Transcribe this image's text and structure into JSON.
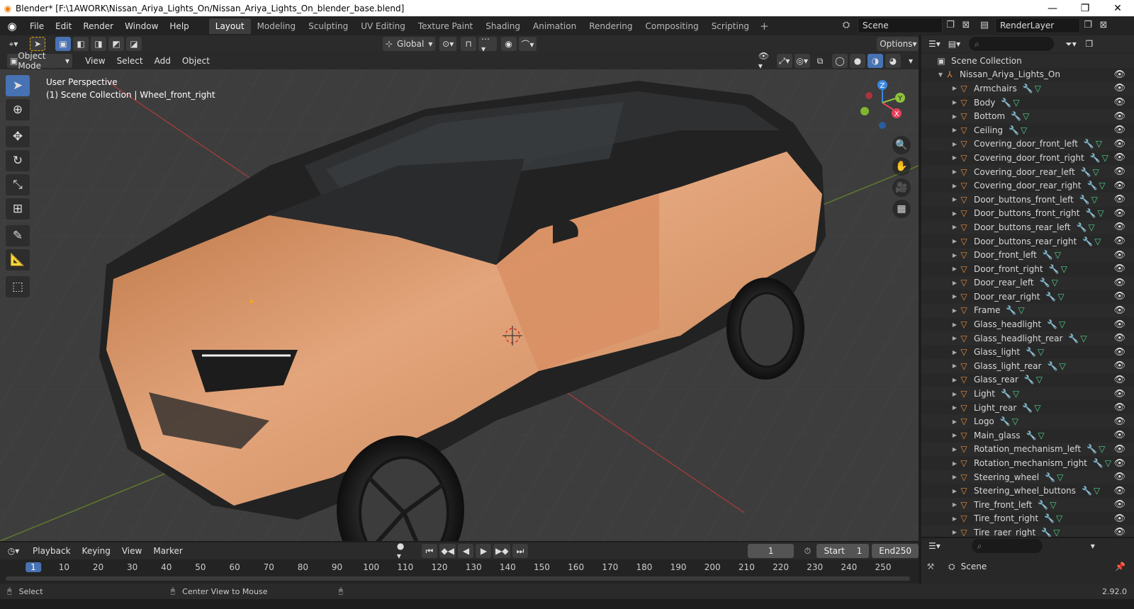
{
  "window": {
    "title": "Blender* [F:\\1AWORK\\Nissan_Ariya_Lights_On/Nissan_Ariya_Lights_On_blender_base.blend]",
    "minimize": "—",
    "maximize": "❐",
    "close": "✕"
  },
  "menus": [
    "File",
    "Edit",
    "Render",
    "Window",
    "Help"
  ],
  "workspaces": [
    "Layout",
    "Modeling",
    "Sculpting",
    "UV Editing",
    "Texture Paint",
    "Shading",
    "Animation",
    "Rendering",
    "Compositing",
    "Scripting"
  ],
  "active_workspace": "Layout",
  "scene": {
    "name": "Scene",
    "render_layer": "RenderLayer"
  },
  "viewport_header": {
    "transform_orientation": "Global",
    "options": "Options",
    "mode": "Object Mode",
    "menus": [
      "View",
      "Select",
      "Add",
      "Object"
    ]
  },
  "viewport_info": {
    "line1": "User Perspective",
    "line2": "(1) Scene Collection | Wheel_front_right"
  },
  "gizmo": {
    "x": "X",
    "y": "Y",
    "z": "Z"
  },
  "outliner": {
    "root": "Scene Collection",
    "collection": "Nissan_Ariya_Lights_On",
    "objects": [
      "Armchairs",
      "Body",
      "Bottom",
      "Ceiling",
      "Covering_door_front_left",
      "Covering_door_front_right",
      "Covering_door_rear_left",
      "Covering_door_rear_right",
      "Door_buttons_front_left",
      "Door_buttons_front_right",
      "Door_buttons_rear_left",
      "Door_buttons_rear_right",
      "Door_front_left",
      "Door_front_right",
      "Door_rear_left",
      "Door_rear_right",
      "Frame",
      "Glass_headlight",
      "Glass_headlight_rear",
      "Glass_light",
      "Glass_light_rear",
      "Glass_rear",
      "Light",
      "Light_rear",
      "Logo",
      "Main_glass",
      "Rotation_mechanism_left",
      "Rotation_mechanism_right",
      "Steering_wheel",
      "Steering_wheel_buttons",
      "Tire_front_left",
      "Tire_front_right",
      "Tire_raer_right"
    ]
  },
  "properties": {
    "scene_label": "Scene"
  },
  "timeline": {
    "menus": [
      "Playback",
      "Keying",
      "View",
      "Marker"
    ],
    "current_frame": "1",
    "start_label": "Start",
    "start": "1",
    "end_label": "End",
    "end": "250",
    "ticks": [
      "1",
      "10",
      "20",
      "30",
      "40",
      "50",
      "60",
      "70",
      "80",
      "90",
      "100",
      "110",
      "120",
      "130",
      "140",
      "150",
      "160",
      "170",
      "180",
      "190",
      "200",
      "210",
      "220",
      "230",
      "240",
      "250"
    ]
  },
  "status": {
    "select": "Select",
    "center_view": "Center View to Mouse",
    "version": "2.92.0"
  },
  "colors": {
    "accent": "#4772b3",
    "car_body": "#d9956a",
    "object_icon": "#e88b3a",
    "modifier_icon": "#5ea1e6",
    "mesh_icon": "#4fd18b",
    "axis_x": "#e4415a",
    "axis_y": "#8fc33a",
    "axis_z": "#3c87e3"
  }
}
